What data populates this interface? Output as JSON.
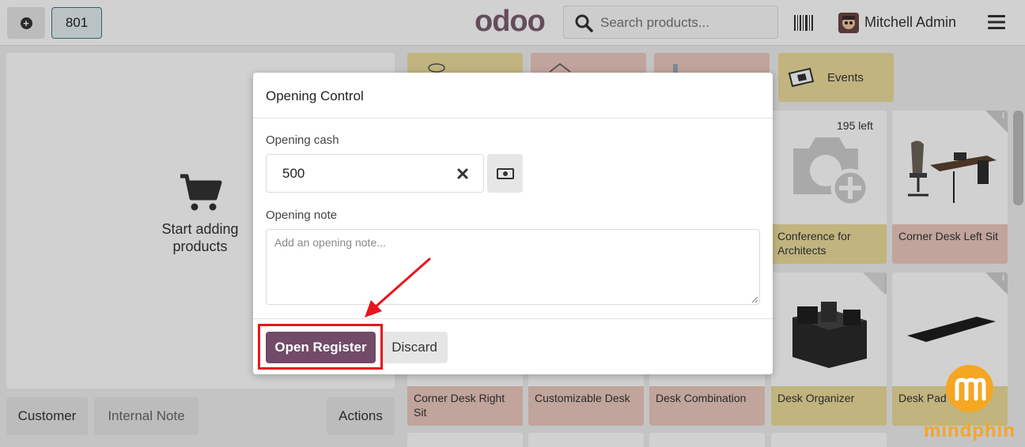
{
  "header": {
    "order_number": "801",
    "logo_text": "odoo",
    "search_placeholder": "Search products...",
    "user_name": "Mitchell Admin"
  },
  "order_pane": {
    "empty_text": "Start adding products",
    "buttons": {
      "customer": "Customer",
      "internal_note": "Internal Note",
      "actions": "Actions"
    }
  },
  "categories": [
    {
      "label": "",
      "color": "#ecdc9a"
    },
    {
      "label": "",
      "color": "#ecc9bd"
    },
    {
      "label": "",
      "color": "#ecc9bd"
    },
    {
      "label": "Events",
      "color": "#ecdc9a"
    }
  ],
  "products_row1": [
    {
      "name": "Conference for Architects",
      "stock": "195 left",
      "color": "#ecdc9a"
    },
    {
      "name": "Corner Desk Left Sit",
      "color": "#ecc9bd"
    }
  ],
  "products_row2": [
    {
      "name": "Corner Desk Right Sit",
      "color": "#ecc9bd"
    },
    {
      "name": "Customizable Desk",
      "color": "#ecc9bd"
    },
    {
      "name": "Desk Combination",
      "color": "#ecc9bd"
    },
    {
      "name": "Desk Organizer",
      "color": "#ecdc9a"
    },
    {
      "name": "Desk Pad",
      "color": "#ecdc9a"
    }
  ],
  "dialog": {
    "title": "Opening Control",
    "opening_cash_label": "Opening cash",
    "opening_cash_value": "500",
    "opening_note_label": "Opening note",
    "opening_note_placeholder": "Add an opening note...",
    "open_button": "Open Register",
    "discard_button": "Discard"
  },
  "colors": {
    "brand": "#714b67",
    "annotation": "#e8141c",
    "watermark": "#f5a623"
  },
  "watermark": {
    "text": "mindphin"
  }
}
